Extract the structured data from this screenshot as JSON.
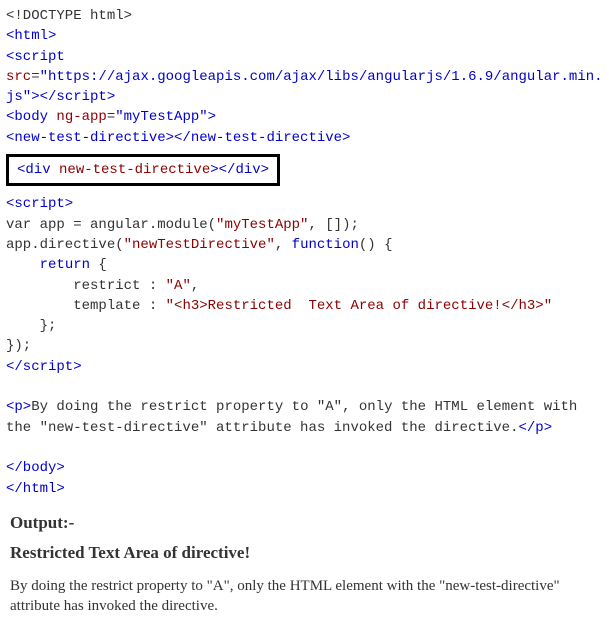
{
  "code": {
    "l1": "<!DOCTYPE html>",
    "l2": "<html>",
    "l3_open": "<script",
    "l3_attr": " src",
    "l3_eq": "=",
    "l3_val": "\"https://ajax.googleapis.com/ajax/libs/angularjs/1.6.9/angular.min.js\"",
    "l3_close": "></script>",
    "l4_open": "<body",
    "l4_attr": " ng-app",
    "l4_eq": "=",
    "l4_val": "\"myTestApp\"",
    "l4_close": ">",
    "l5_open": "<new-test-directive>",
    "l5_close": "</new-test-directive>",
    "boxed_open": "<div",
    "boxed_attr": " new-test-directive",
    "boxed_close1": ">",
    "boxed_close2": "</div>",
    "l6": "<script>",
    "l7": "var app = angular.module(",
    "l7_str": "\"myTestApp\"",
    "l7_rest": ", []);",
    "l8": "app.directive(",
    "l8_str": "\"newTestDirective\"",
    "l8_mid": ", ",
    "l8_kw": "function",
    "l8_rest": "() {",
    "l9a": "    ",
    "l9_kw": "return",
    "l9b": " {",
    "l10a": "        restrict : ",
    "l10_str": "\"A\"",
    "l10b": ",",
    "l11a": "        template : ",
    "l11_str": "\"<h3>Restricted  Text Area of directive!</h3>\"",
    "l12": "    };",
    "l13": "});",
    "l14": "</script>",
    "l15_open": "<p>",
    "l15_text": "By doing the restrict property to \"A\", only the HTML element with the \"new-test-directive\" attribute has invoked the directive.",
    "l15_close": "</p>",
    "l16": "</body>",
    "l17": "</html>"
  },
  "output": {
    "label": "Output:-",
    "heading": "Restricted Text Area of directive!",
    "paragraph": "By doing the restrict property to \"A\", only the HTML element with the \"new-test-directive\" attribute has invoked the directive."
  }
}
